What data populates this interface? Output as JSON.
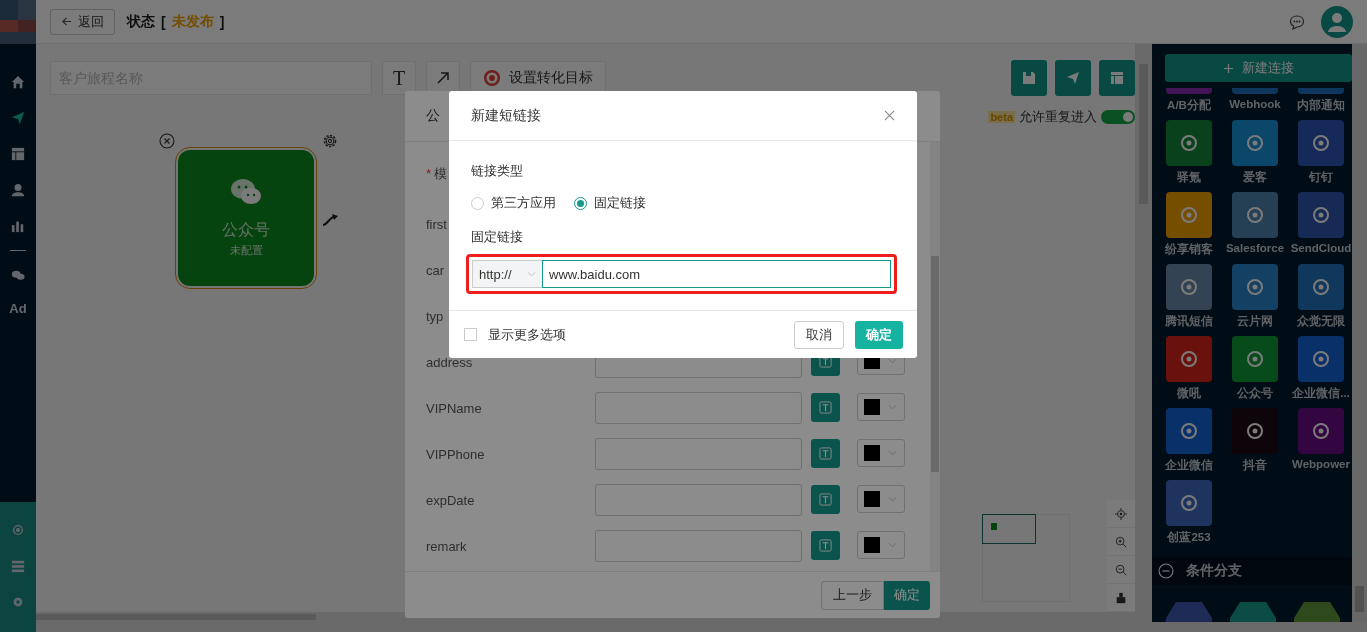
{
  "nav": {
    "items": [
      {
        "selected": false
      },
      {
        "selected": true
      },
      {
        "selected": false
      },
      {
        "selected": false
      },
      {
        "selected": false
      },
      {
        "selected": false
      },
      {
        "selected": false,
        "label": "Ad"
      }
    ],
    "bottom_items": [
      {
        "selected": false
      },
      {
        "selected": false
      },
      {
        "selected": false
      }
    ]
  },
  "header": {
    "back": "返回",
    "status_label": "状态",
    "bracket_open": "[",
    "status": "未发布",
    "bracket_close": "]"
  },
  "toolbar": {
    "name_placeholder": "客户旅程名称",
    "text_tool": "T",
    "goal_button": "设置转化目标"
  },
  "reentry": {
    "badge": "beta",
    "label": "允许重复进入",
    "on": true
  },
  "node": {
    "title": "公众号",
    "status": "未配置",
    "selected": true
  },
  "panel": {
    "new_button": "新建连接",
    "items": [
      {
        "label": "A/B分配",
        "color": "#431555",
        "cut": true
      },
      {
        "label": "Webhook",
        "color": "#0f365d",
        "cut": true
      },
      {
        "label": "内部通知",
        "color": "#0f365d",
        "cut": true
      },
      {
        "label": "驿氪",
        "color": "#08411c",
        "cut": false
      },
      {
        "label": "爱客",
        "color": "#0a4769",
        "cut": false
      },
      {
        "label": "钉钉",
        "color": "#162a59",
        "cut": false
      },
      {
        "label": "纷享销客",
        "color": "#754e00",
        "cut": false
      },
      {
        "label": "Salesforce",
        "color": "#254055",
        "cut": false
      },
      {
        "label": "SendCloud",
        "color": "#162a55",
        "cut": false
      },
      {
        "label": "腾讯短信",
        "color": "#344353",
        "cut": false
      },
      {
        "label": "云片网",
        "color": "#144163",
        "cut": false
      },
      {
        "label": "众觉无限",
        "color": "#0f385c",
        "cut": false
      },
      {
        "label": "微吼",
        "color": "#69110d",
        "cut": false
      },
      {
        "label": "公众号",
        "color": "#064b19",
        "cut": false
      },
      {
        "label": "企业微信...",
        "color": "#0a3069",
        "cut": false
      },
      {
        "label": "企业微信",
        "color": "#0a3069",
        "cut": false
      },
      {
        "label": "抖音",
        "color": "#0d050a",
        "cut": false
      },
      {
        "label": "Webpower",
        "color": "#340641",
        "cut": false
      },
      {
        "label": "创蓝253",
        "color": "#1e345f",
        "cut": false
      }
    ],
    "section": "条件分支",
    "section_expanded": true,
    "branch_items": [
      {
        "color": "#1e2b57"
      },
      {
        "color": "#0b4d45"
      },
      {
        "color": "#2e4a1d"
      }
    ]
  },
  "config_modal": {
    "title": "公",
    "required_mark": "*",
    "rows": [
      {
        "label": "模",
        "required": true,
        "kind": "label"
      },
      {
        "label": "first",
        "required": false,
        "kind": "label"
      },
      {
        "label": "car",
        "required": false,
        "kind": "label"
      },
      {
        "label": "typ",
        "required": false,
        "kind": "label"
      },
      {
        "label": "address",
        "required": false,
        "kind": "field",
        "color": "#000000"
      },
      {
        "label": "VIPName",
        "required": false,
        "kind": "field",
        "color": "#000000"
      },
      {
        "label": "VIPPhone",
        "required": false,
        "kind": "field",
        "color": "#000000"
      },
      {
        "label": "expDate",
        "required": false,
        "kind": "field",
        "color": "#000000"
      },
      {
        "label": "remark",
        "required": false,
        "kind": "field",
        "color": "#000000"
      }
    ],
    "back_button": "上一步",
    "ok_button": "确定"
  },
  "link_dialog": {
    "title": "新建短链接",
    "type_label": "链接类型",
    "options": [
      {
        "label": "第三方应用",
        "selected": false
      },
      {
        "label": "固定链接",
        "selected": true
      }
    ],
    "link_label": "固定链接",
    "protocol": "http://",
    "url": "www.baidu.com",
    "highlighted": true,
    "more_options": {
      "label": "显示更多选项",
      "checked": false
    },
    "cancel_button": "取消",
    "ok_button": "确定"
  }
}
